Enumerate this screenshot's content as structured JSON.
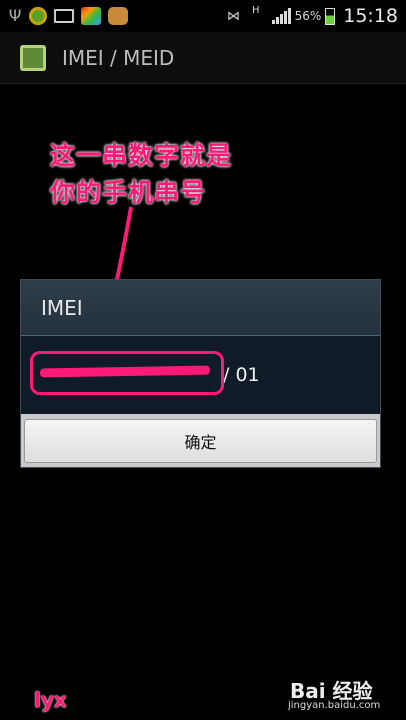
{
  "status_bar": {
    "icons": [
      "usb-icon",
      "app-icon",
      "mail-icon",
      "app-icon",
      "app-icon"
    ],
    "network": "H",
    "battery_level": "56%",
    "time": "15:18"
  },
  "action_bar": {
    "title": "IMEI / MEID"
  },
  "annotation": {
    "line1": "这一串数字就是",
    "line2": "你的手机串号"
  },
  "dialog": {
    "title": "IMEI",
    "value_suffix": "/ 01",
    "ok_label": "确定"
  },
  "watermarks": {
    "author": "lyx",
    "brand": "Bai 经验",
    "url": "jingyan.baidu.com"
  },
  "colors": {
    "annotation": "#ff1a78",
    "dialog_header": "#2e3d4a",
    "dialog_body": "#0f1b26"
  }
}
